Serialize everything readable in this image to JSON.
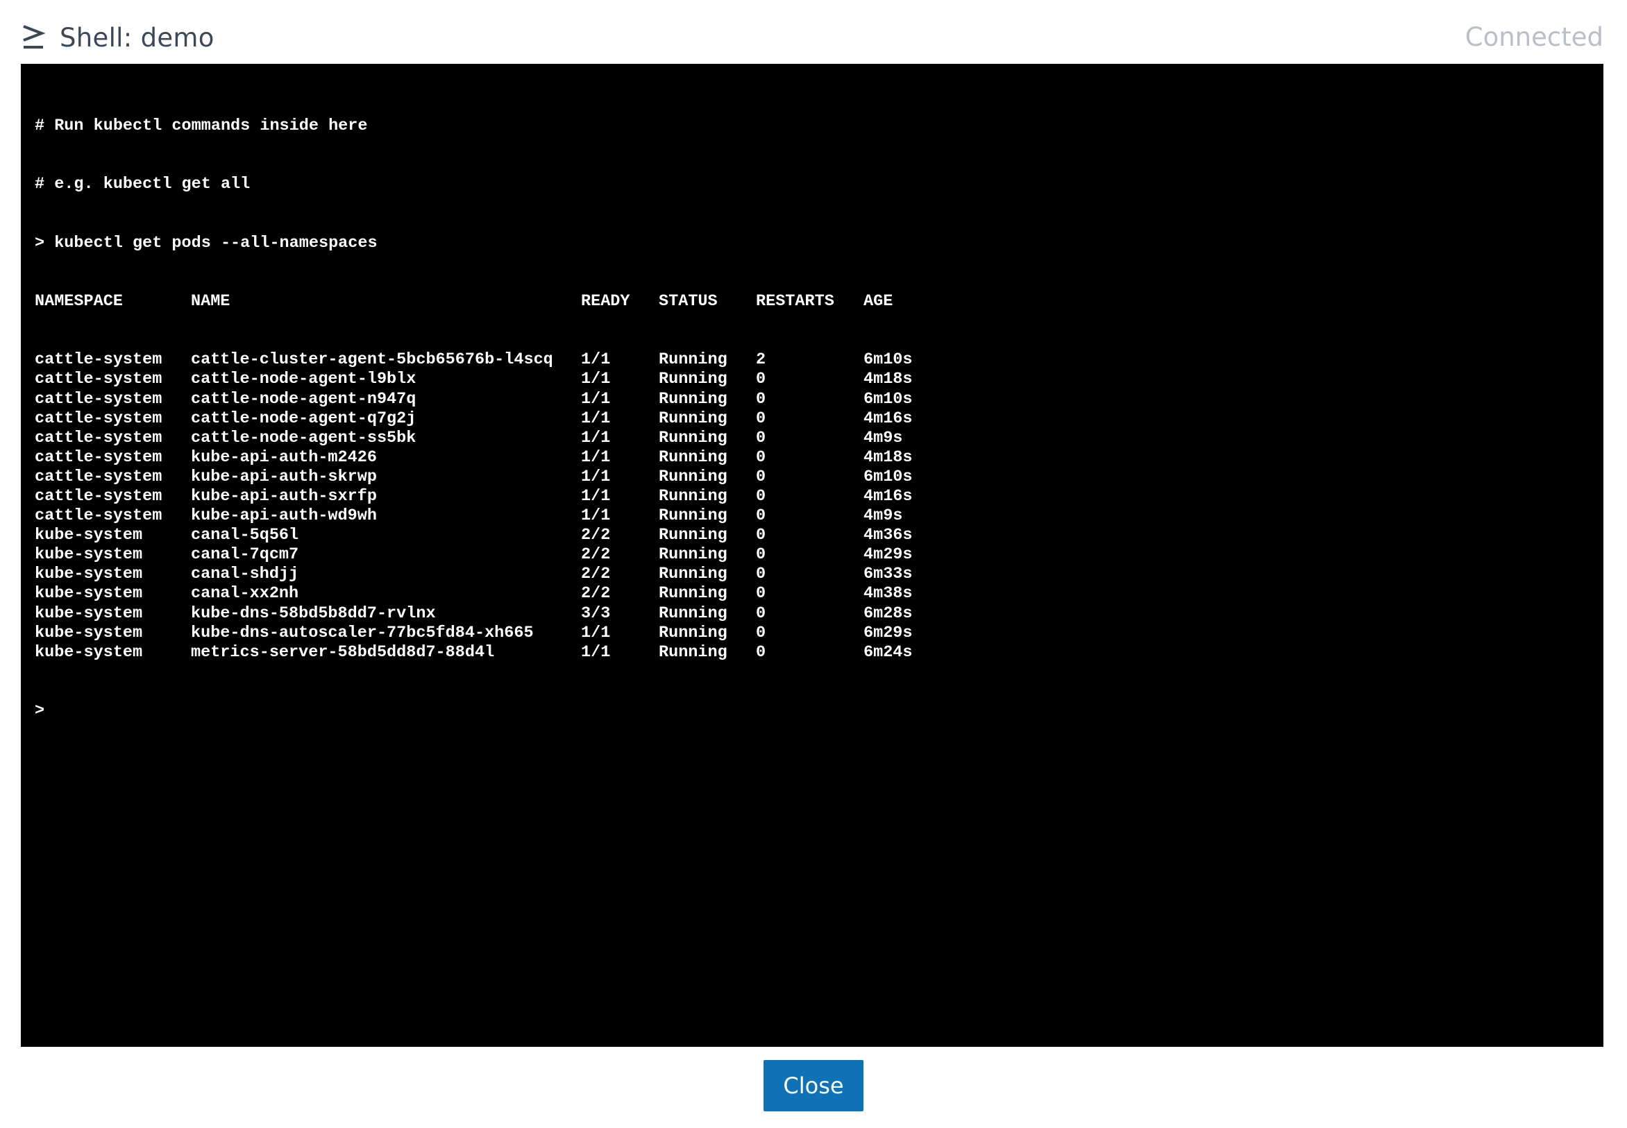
{
  "header": {
    "icon": "terminal-prompt-icon",
    "title": "Shell: demo",
    "status": "Connected"
  },
  "colors": {
    "title": "#3c4858",
    "status": "#b8bfc7",
    "terminal_bg": "#000000",
    "terminal_text": "#ffffff",
    "button_bg": "#0f72b6"
  },
  "terminal": {
    "intro_lines": [
      "# Run kubectl commands inside here",
      "# e.g. kubectl get all",
      "> kubectl get pods --all-namespaces"
    ],
    "columns": [
      "NAMESPACE",
      "NAME",
      "READY",
      "STATUS",
      "RESTARTS",
      "AGE"
    ],
    "pods": [
      {
        "namespace": "cattle-system",
        "name": "cattle-cluster-agent-5bcb65676b-l4scq",
        "ready": "1/1",
        "status": "Running",
        "restarts": "2",
        "age": "6m10s"
      },
      {
        "namespace": "cattle-system",
        "name": "cattle-node-agent-l9blx",
        "ready": "1/1",
        "status": "Running",
        "restarts": "0",
        "age": "4m18s"
      },
      {
        "namespace": "cattle-system",
        "name": "cattle-node-agent-n947q",
        "ready": "1/1",
        "status": "Running",
        "restarts": "0",
        "age": "6m10s"
      },
      {
        "namespace": "cattle-system",
        "name": "cattle-node-agent-q7g2j",
        "ready": "1/1",
        "status": "Running",
        "restarts": "0",
        "age": "4m16s"
      },
      {
        "namespace": "cattle-system",
        "name": "cattle-node-agent-ss5bk",
        "ready": "1/1",
        "status": "Running",
        "restarts": "0",
        "age": "4m9s"
      },
      {
        "namespace": "cattle-system",
        "name": "kube-api-auth-m2426",
        "ready": "1/1",
        "status": "Running",
        "restarts": "0",
        "age": "4m18s"
      },
      {
        "namespace": "cattle-system",
        "name": "kube-api-auth-skrwp",
        "ready": "1/1",
        "status": "Running",
        "restarts": "0",
        "age": "6m10s"
      },
      {
        "namespace": "cattle-system",
        "name": "kube-api-auth-sxrfp",
        "ready": "1/1",
        "status": "Running",
        "restarts": "0",
        "age": "4m16s"
      },
      {
        "namespace": "cattle-system",
        "name": "kube-api-auth-wd9wh",
        "ready": "1/1",
        "status": "Running",
        "restarts": "0",
        "age": "4m9s"
      },
      {
        "namespace": "kube-system",
        "name": "canal-5q56l",
        "ready": "2/2",
        "status": "Running",
        "restarts": "0",
        "age": "4m36s"
      },
      {
        "namespace": "kube-system",
        "name": "canal-7qcm7",
        "ready": "2/2",
        "status": "Running",
        "restarts": "0",
        "age": "4m29s"
      },
      {
        "namespace": "kube-system",
        "name": "canal-shdjj",
        "ready": "2/2",
        "status": "Running",
        "restarts": "0",
        "age": "6m33s"
      },
      {
        "namespace": "kube-system",
        "name": "canal-xx2nh",
        "ready": "2/2",
        "status": "Running",
        "restarts": "0",
        "age": "4m38s"
      },
      {
        "namespace": "kube-system",
        "name": "kube-dns-58bd5b8dd7-rvlnx",
        "ready": "3/3",
        "status": "Running",
        "restarts": "0",
        "age": "6m28s"
      },
      {
        "namespace": "kube-system",
        "name": "kube-dns-autoscaler-77bc5fd84-xh665",
        "ready": "1/1",
        "status": "Running",
        "restarts": "0",
        "age": "6m29s"
      },
      {
        "namespace": "kube-system",
        "name": "metrics-server-58bd5dd8d7-88d4l",
        "ready": "1/1",
        "status": "Running",
        "restarts": "0",
        "age": "6m24s"
      }
    ],
    "prompt": ">"
  },
  "footer": {
    "close_label": "Close"
  }
}
